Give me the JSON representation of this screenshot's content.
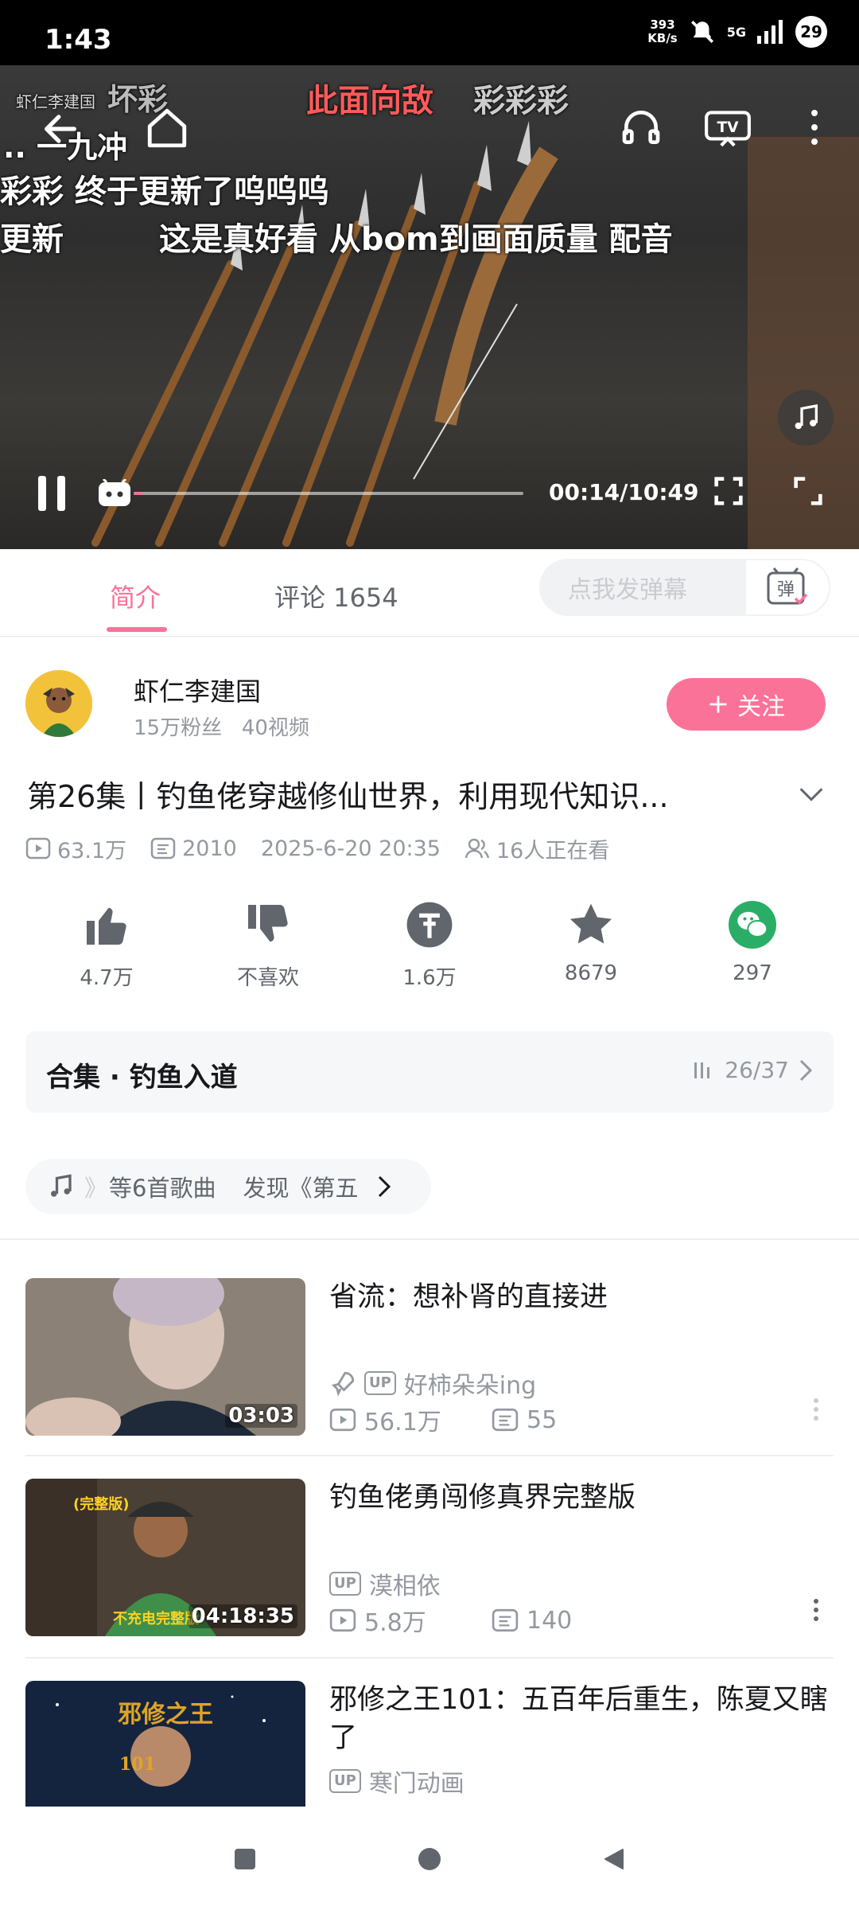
{
  "status_bar": {
    "time": "1:43",
    "net_speed_value": "393",
    "net_speed_unit": "KB/s",
    "network": "5G",
    "battery": "29"
  },
  "player": {
    "watermark": "虾仁李建国",
    "danmaku": {
      "top_a": "坏彩",
      "top_red": "此面向敌",
      "top_b": "彩彩彩",
      "dots": "..   一九冲",
      "line1": "彩彩   终于更新了呜呜呜",
      "line2": "更新",
      "line3": "这是真好看    从bom到画面质量  配音"
    },
    "time_display": "00:14/10:49",
    "progress_fraction": 0.0216
  },
  "tabs": {
    "intro": "简介",
    "comments": "评论 1654",
    "danmaku_placeholder": "点我发弹幕",
    "danmaku_btn": "弹"
  },
  "uploader": {
    "name": "虾仁李建国",
    "fans": "15万粉丝",
    "videos": "40视频",
    "follow": "关注"
  },
  "video": {
    "title": "第26集丨钓鱼佬穿越修仙世界，利用现代知识...",
    "views": "63.1万",
    "danmaku_count": "2010",
    "date": "2025-6-20 20:35",
    "watching": "16人正在看"
  },
  "actions": {
    "like": "4.7万",
    "dislike": "不喜欢",
    "coin": "1.6万",
    "favorite": "8679",
    "share": "297"
  },
  "collection": {
    "title": "合集 · 钓鱼入道",
    "progress": "26/37"
  },
  "music": {
    "text_faded": "》",
    "text": "等6首歌曲",
    "text2": "发现《第五"
  },
  "recommendations": [
    {
      "title": "省流：想补肾的直接进",
      "up": "好柿朵朵ing",
      "views": "56.1万",
      "danmaku": "55",
      "duration": "03:03"
    },
    {
      "title": "钓鱼佬勇闯修真界完整版",
      "up": "漠相依",
      "views": "5.8万",
      "danmaku": "140",
      "duration": "04:18:35",
      "thumb_tag": "(完整版)",
      "thumb_caption": "不充电完整版"
    },
    {
      "title": "邪修之王101：五百年后重生，陈夏又瞎了",
      "up": "寒门动画",
      "thumb_text": "邪修之王",
      "thumb_num": "101"
    }
  ],
  "up_badge": "UP",
  "colors": {
    "accent": "#fb7299",
    "wechat": "#2aae67",
    "text_secondary": "#9499a0"
  }
}
